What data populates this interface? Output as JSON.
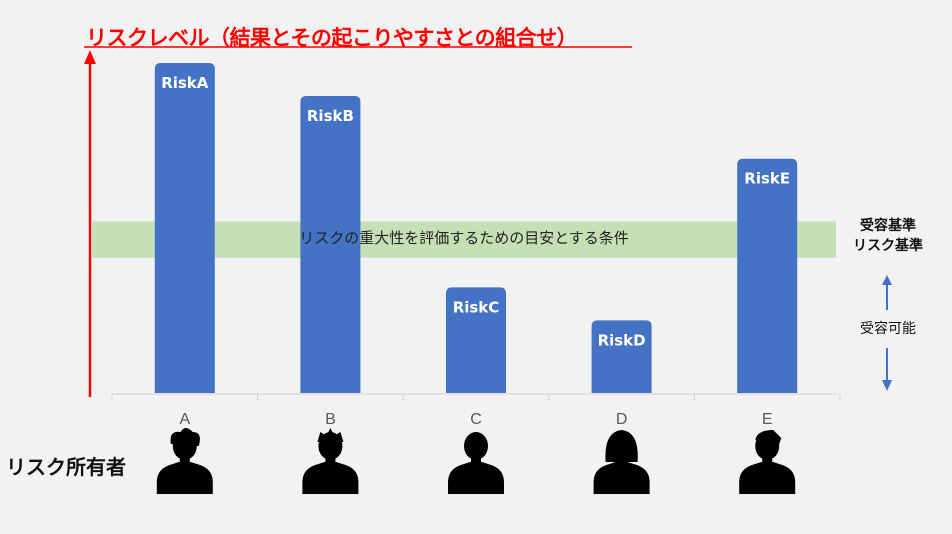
{
  "title": "リスクレベル（結果とその起こりやすさとの組合せ）",
  "band_text": "リスクの重大性を評価するための目安とする条件",
  "right_labels": {
    "criteria_line1": "受容基準",
    "criteria_line2": "リスク基準",
    "acceptable": "受容可能"
  },
  "owner_label": "リスク所有者",
  "colors": {
    "bar": "#4472c4",
    "band": "#c5e0b4",
    "title": "#ff0000",
    "arrow": "#4472c4"
  },
  "chart_data": {
    "type": "bar",
    "title": "リスクレベル（結果とその起こりやすさとの組合せ）",
    "categories": [
      "A",
      "B",
      "C",
      "D",
      "E"
    ],
    "bar_labels": [
      "RiskA",
      "RiskB",
      "RiskC",
      "RiskD",
      "RiskE"
    ],
    "values": [
      10,
      9.0,
      3.2,
      2.2,
      7.1
    ],
    "ylim": [
      0,
      10
    ],
    "threshold_band": [
      4.1,
      5.2
    ],
    "owner_icons": [
      "person-curly-hair-icon",
      "person-spiky-hair-icon",
      "person-short-hair-icon",
      "person-woman-icon",
      "person-side-part-icon"
    ],
    "grid": false,
    "xlabel": "",
    "ylabel": ""
  }
}
